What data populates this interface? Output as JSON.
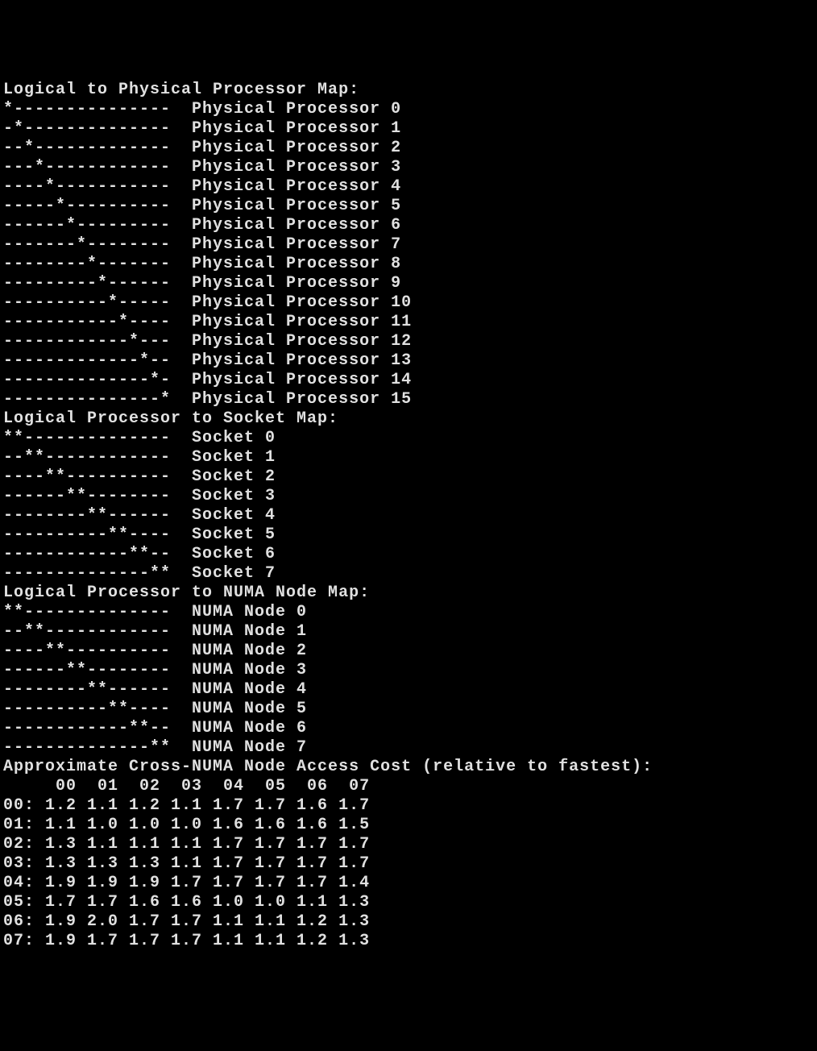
{
  "sections": {
    "physical": {
      "title": "Logical to Physical Processor Map:",
      "rows": [
        {
          "pattern": "*---------------",
          "label": "Physical Processor 0"
        },
        {
          "pattern": "-*--------------",
          "label": "Physical Processor 1"
        },
        {
          "pattern": "--*-------------",
          "label": "Physical Processor 2"
        },
        {
          "pattern": "---*------------",
          "label": "Physical Processor 3"
        },
        {
          "pattern": "----*-----------",
          "label": "Physical Processor 4"
        },
        {
          "pattern": "-----*----------",
          "label": "Physical Processor 5"
        },
        {
          "pattern": "------*---------",
          "label": "Physical Processor 6"
        },
        {
          "pattern": "-------*--------",
          "label": "Physical Processor 7"
        },
        {
          "pattern": "--------*-------",
          "label": "Physical Processor 8"
        },
        {
          "pattern": "---------*------",
          "label": "Physical Processor 9"
        },
        {
          "pattern": "----------*-----",
          "label": "Physical Processor 10"
        },
        {
          "pattern": "-----------*----",
          "label": "Physical Processor 11"
        },
        {
          "pattern": "------------*---",
          "label": "Physical Processor 12"
        },
        {
          "pattern": "-------------*--",
          "label": "Physical Processor 13"
        },
        {
          "pattern": "--------------*-",
          "label": "Physical Processor 14"
        },
        {
          "pattern": "---------------*",
          "label": "Physical Processor 15"
        }
      ]
    },
    "socket": {
      "title": "Logical Processor to Socket Map:",
      "rows": [
        {
          "pattern": "**--------------",
          "label": "Socket 0"
        },
        {
          "pattern": "--**------------",
          "label": "Socket 1"
        },
        {
          "pattern": "----**----------",
          "label": "Socket 2"
        },
        {
          "pattern": "------**--------",
          "label": "Socket 3"
        },
        {
          "pattern": "--------**------",
          "label": "Socket 4"
        },
        {
          "pattern": "----------**----",
          "label": "Socket 5"
        },
        {
          "pattern": "------------**--",
          "label": "Socket 6"
        },
        {
          "pattern": "--------------**",
          "label": "Socket 7"
        }
      ]
    },
    "numa": {
      "title": "Logical Processor to NUMA Node Map:",
      "rows": [
        {
          "pattern": "**--------------",
          "label": "NUMA Node 0"
        },
        {
          "pattern": "--**------------",
          "label": "NUMA Node 1"
        },
        {
          "pattern": "----**----------",
          "label": "NUMA Node 2"
        },
        {
          "pattern": "------**--------",
          "label": "NUMA Node 3"
        },
        {
          "pattern": "--------**------",
          "label": "NUMA Node 4"
        },
        {
          "pattern": "----------**----",
          "label": "NUMA Node 5"
        },
        {
          "pattern": "------------**--",
          "label": "NUMA Node 6"
        },
        {
          "pattern": "--------------**",
          "label": "NUMA Node 7"
        }
      ]
    },
    "cost": {
      "title": "Approximate Cross-NUMA Node Access Cost (relative to fastest):",
      "headers": [
        "00",
        "01",
        "02",
        "03",
        "04",
        "05",
        "06",
        "07"
      ],
      "rows": [
        {
          "label": "00:",
          "values": [
            "1.2",
            "1.1",
            "1.2",
            "1.1",
            "1.7",
            "1.7",
            "1.6",
            "1.7"
          ]
        },
        {
          "label": "01:",
          "values": [
            "1.1",
            "1.0",
            "1.0",
            "1.0",
            "1.6",
            "1.6",
            "1.6",
            "1.5"
          ]
        },
        {
          "label": "02:",
          "values": [
            "1.3",
            "1.1",
            "1.1",
            "1.1",
            "1.7",
            "1.7",
            "1.7",
            "1.7"
          ]
        },
        {
          "label": "03:",
          "values": [
            "1.3",
            "1.3",
            "1.3",
            "1.1",
            "1.7",
            "1.7",
            "1.7",
            "1.7"
          ]
        },
        {
          "label": "04:",
          "values": [
            "1.9",
            "1.9",
            "1.9",
            "1.7",
            "1.7",
            "1.7",
            "1.7",
            "1.4"
          ]
        },
        {
          "label": "05:",
          "values": [
            "1.7",
            "1.7",
            "1.6",
            "1.6",
            "1.0",
            "1.0",
            "1.1",
            "1.3"
          ]
        },
        {
          "label": "06:",
          "values": [
            "1.9",
            "2.0",
            "1.7",
            "1.7",
            "1.1",
            "1.1",
            "1.2",
            "1.3"
          ]
        },
        {
          "label": "07:",
          "values": [
            "1.9",
            "1.7",
            "1.7",
            "1.7",
            "1.1",
            "1.1",
            "1.2",
            "1.3"
          ]
        }
      ]
    }
  }
}
